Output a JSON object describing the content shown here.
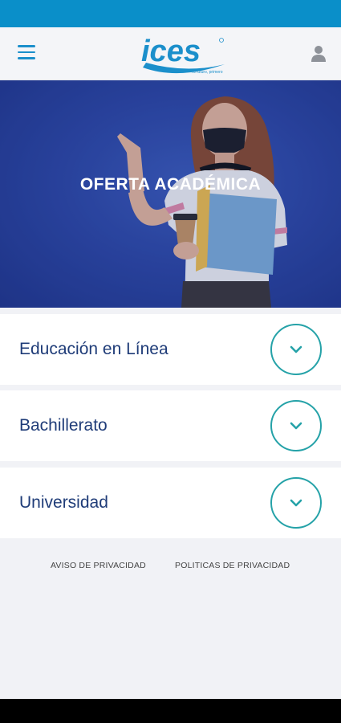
{
  "header": {
    "logo_text": "ices",
    "logo_tagline": "Tu futuro, primero",
    "menu_icon": "hamburger-menu-icon",
    "user_icon": "user-profile-icon",
    "brand_color": "#1b8fcb"
  },
  "hero": {
    "title": "OFERTA ACADÉMICA"
  },
  "sections": [
    {
      "label": "Educación en Línea",
      "icon": "chevron-down-icon"
    },
    {
      "label": "Bachillerato",
      "icon": "chevron-down-icon"
    },
    {
      "label": "Universidad",
      "icon": "chevron-down-icon"
    }
  ],
  "footer": {
    "privacy_notice": "AVISO DE PRIVACIDAD",
    "privacy_policies": "POLITICAS DE PRIVACIDAD"
  },
  "colors": {
    "status_bar": "#0a8fc9",
    "accent_teal": "#25a2a8",
    "text_navy": "#1f3c78",
    "hero_blue": "#2c46a3"
  }
}
